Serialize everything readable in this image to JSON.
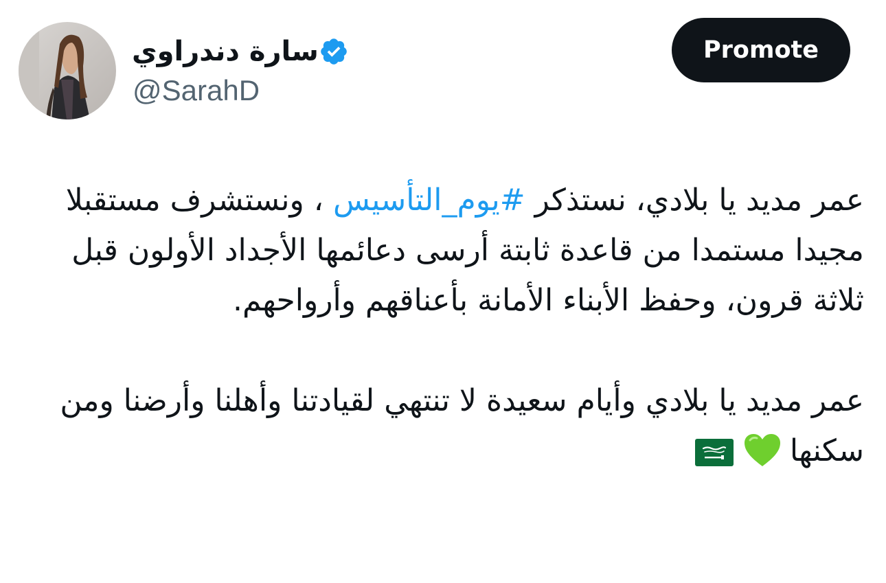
{
  "header": {
    "display_name": "سارة دندراوي",
    "handle": "@SarahD",
    "promote_label": "Promote",
    "verified": true,
    "verified_icon": "verified-badge-icon",
    "avatar_icon": "avatar"
  },
  "tweet": {
    "para1_before": "عمر مديد يا بلادي، نستذكر ",
    "hashtag": "#يوم_التأسيس",
    "para1_after": " ، ونستشرف مستقبلا مجيدا مستمدا من قاعدة ثابتة أرسى دعائمها الأجداد الأولون قبل ثلاثة قرون، وحفظ الأبناء الأمانة بأعناقهم وأرواحهم.",
    "para2": "عمر مديد يا بلادي وأيام سعيدة لا تنتهي لقيادتنا وأهلنا وأرضنا ومن سكنها",
    "emoji_heart": "green-heart-icon",
    "emoji_flag": "saudi-flag-icon"
  },
  "colors": {
    "text": "#0f1419",
    "secondary": "#536471",
    "link": "#1d9bf0",
    "verified": "#1d9bf0",
    "button_bg": "#0f1419"
  }
}
